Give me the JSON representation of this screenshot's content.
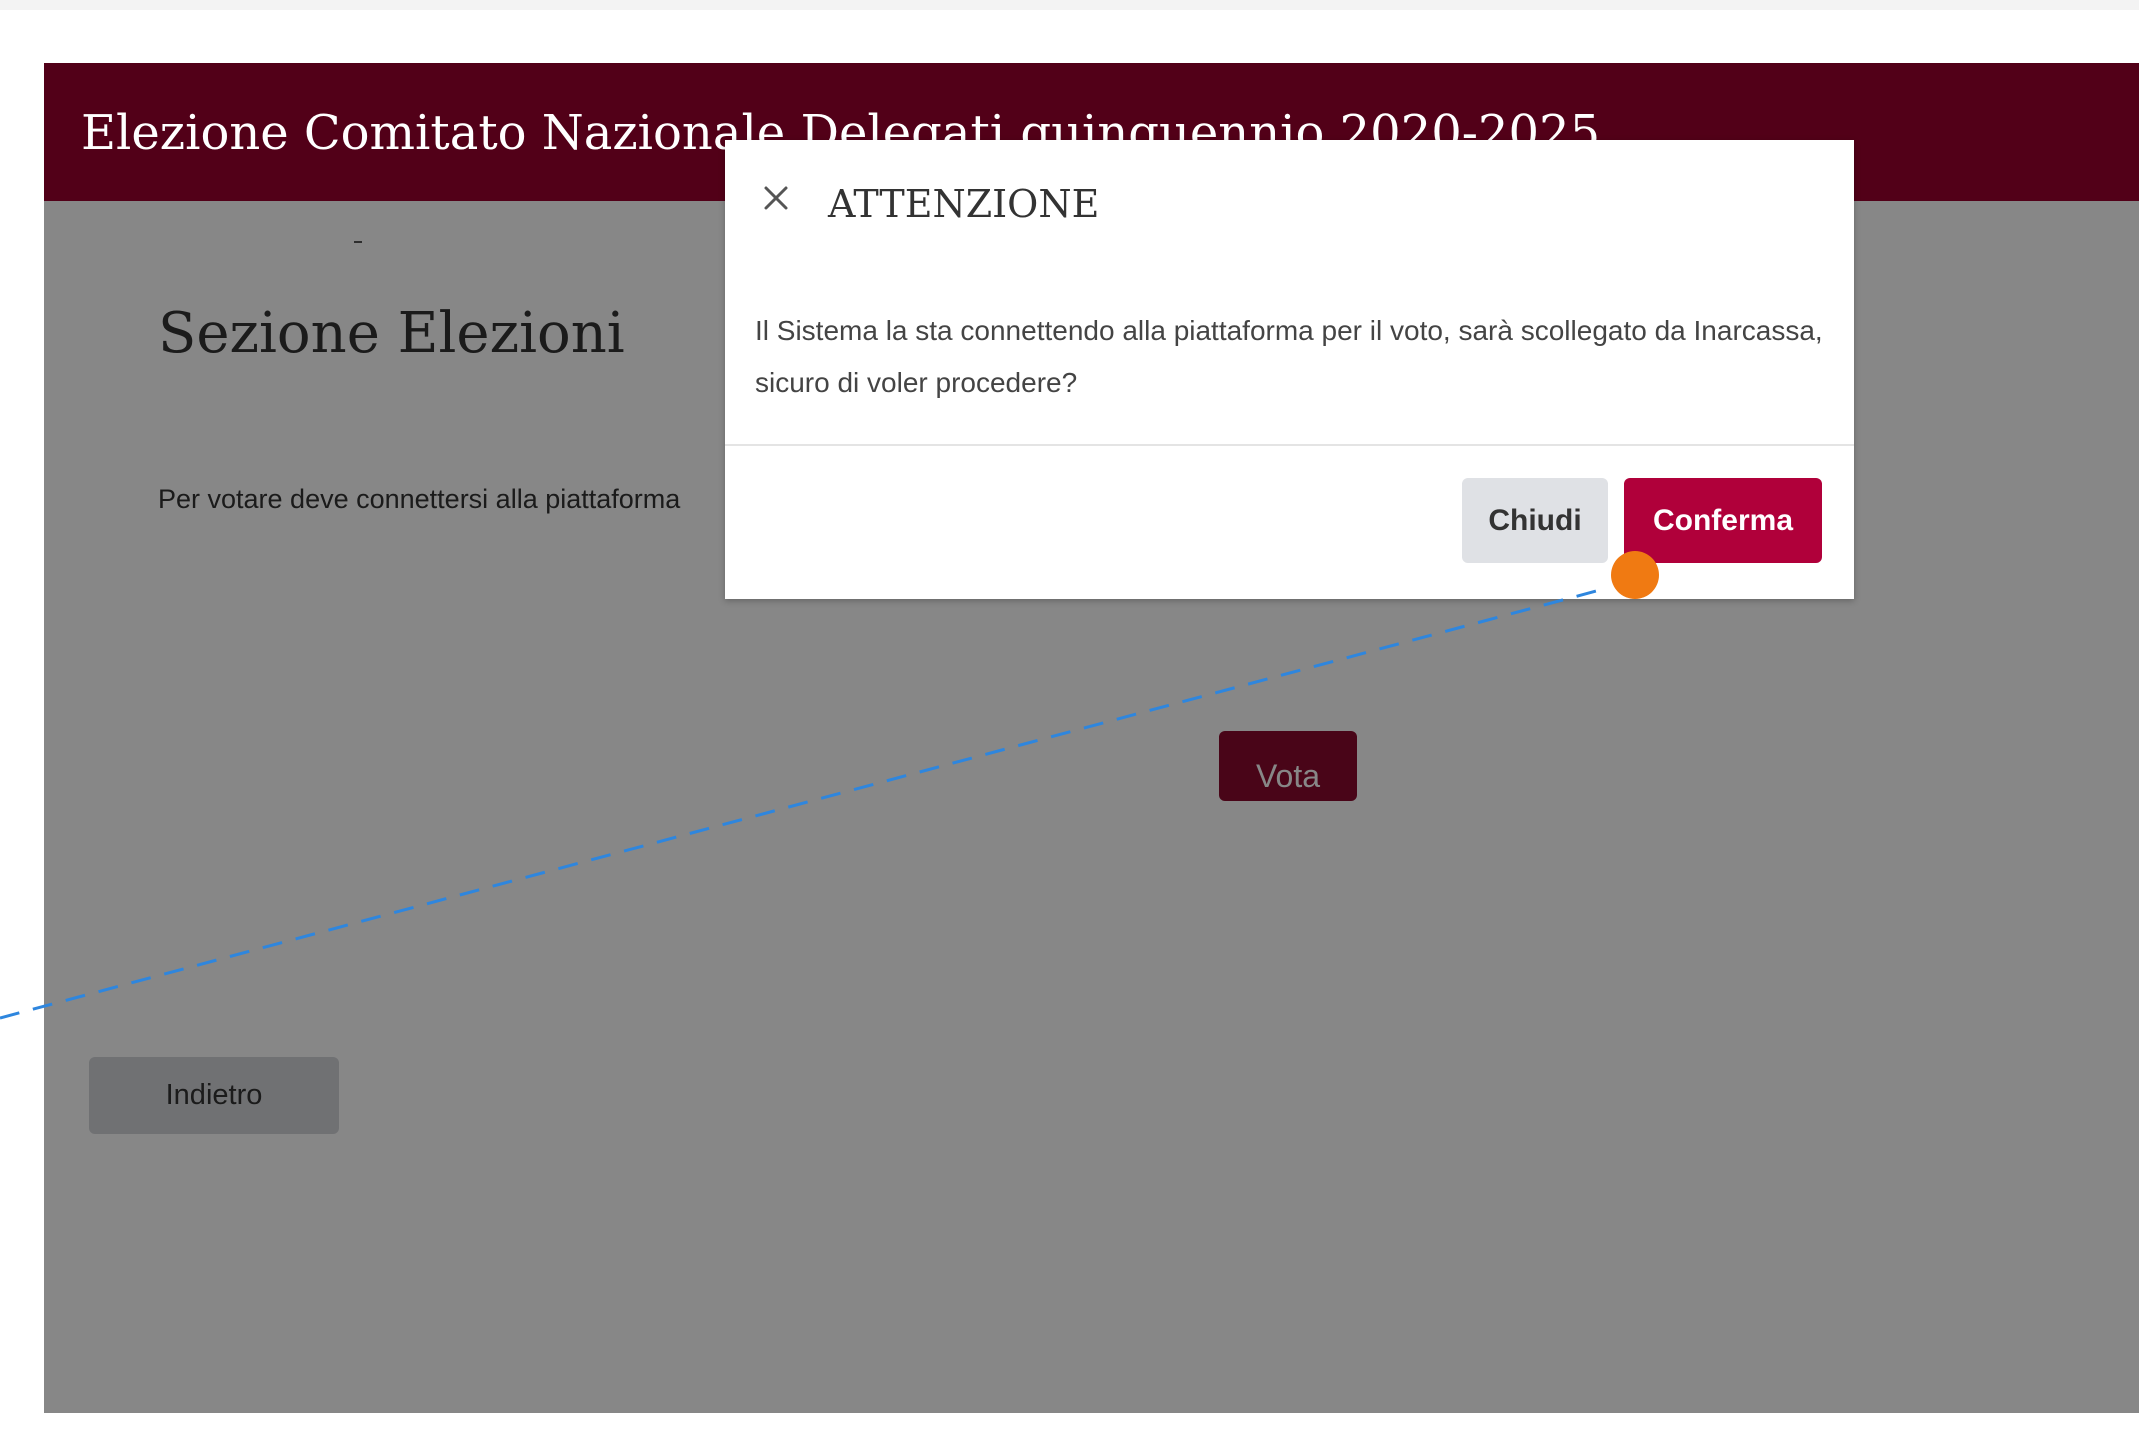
{
  "header": {
    "title": "Elezione Comitato Nazionale Delegati quinquennio 2020-2025",
    "background_color": "#520018"
  },
  "section": {
    "title": "Sezione Elezioni",
    "description": "Per votare deve connettersi alla piattaforma",
    "vote_button_label": "Vota",
    "back_button_label": "Indietro"
  },
  "modal": {
    "close_icon": "close-icon",
    "title": "ATTENZIONE",
    "body": "Il Sistema la sta connettendo alla piattaforma per il voto, sarà scollegato da Inarcassa, sicuro di voler procedere?",
    "close_button_label": "Chiudi",
    "confirm_button_label": "Conferma",
    "confirm_color": "#b0003a"
  },
  "cursor": {
    "marker_color": "#f07a12",
    "trail_color": "#2e86de"
  }
}
